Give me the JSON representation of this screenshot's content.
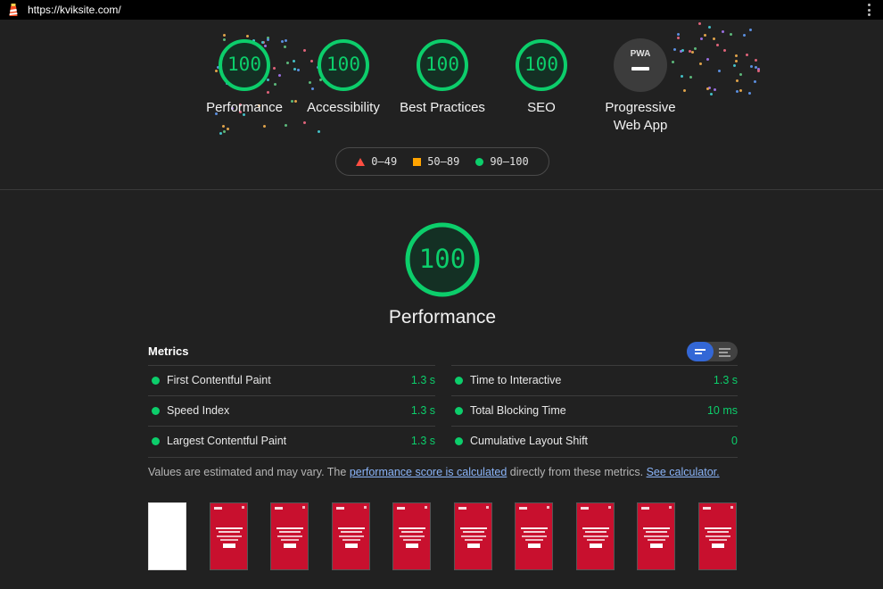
{
  "address_bar": {
    "url": "https://kviksite.com/"
  },
  "gauges": [
    {
      "label": "Performance",
      "score": "100"
    },
    {
      "label": "Accessibility",
      "score": "100"
    },
    {
      "label": "Best Practices",
      "score": "100"
    },
    {
      "label": "SEO",
      "score": "100"
    },
    {
      "label": "Progressive Web App",
      "badge": "PWA"
    }
  ],
  "legend": {
    "fail": "0–49",
    "average": "50–89",
    "pass": "90–100"
  },
  "category": {
    "title": "Performance",
    "score": "100"
  },
  "metrics": {
    "heading": "Metrics",
    "items": [
      {
        "name": "First Contentful Paint",
        "value": "1.3 s"
      },
      {
        "name": "Time to Interactive",
        "value": "1.3 s"
      },
      {
        "name": "Speed Index",
        "value": "1.3 s"
      },
      {
        "name": "Total Blocking Time",
        "value": "10 ms"
      },
      {
        "name": "Largest Contentful Paint",
        "value": "1.3 s"
      },
      {
        "name": "Cumulative Layout Shift",
        "value": "0"
      }
    ]
  },
  "note": {
    "prefix": "Values are estimated and may vary. The ",
    "link1": "performance score is calculated",
    "middle": " directly from these metrics. ",
    "link2": "See calculator."
  },
  "filmstrip": {
    "frames": 10
  },
  "colors": {
    "pass": "#0cce6b",
    "average": "#ffa400",
    "fail": "#ff4e42",
    "toggle": "#3367d6",
    "link": "#8ab4f8"
  }
}
